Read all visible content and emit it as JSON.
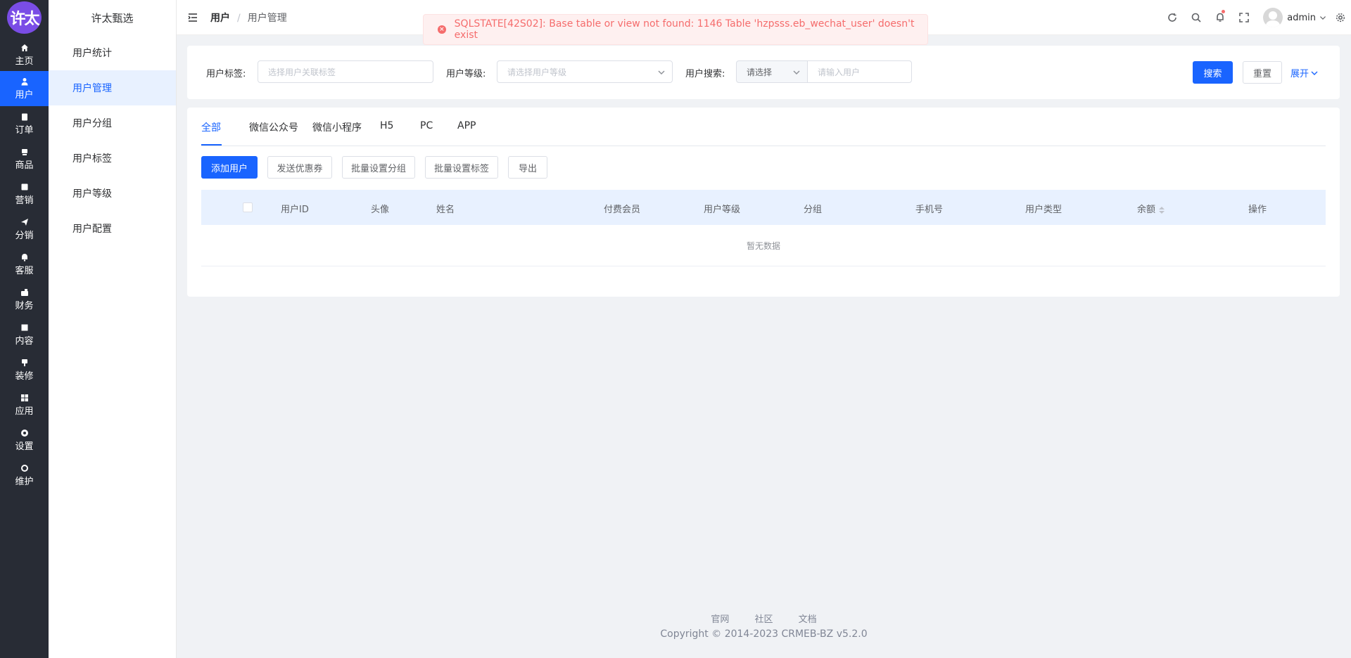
{
  "brand": {
    "logo_text": "许太",
    "name": "许太甄选"
  },
  "rail": [
    {
      "label": "主页",
      "icon": "home-icon"
    },
    {
      "label": "用户",
      "icon": "user-icon"
    },
    {
      "label": "订单",
      "icon": "clipboard-icon"
    },
    {
      "label": "商品",
      "icon": "box-icon"
    },
    {
      "label": "营销",
      "icon": "chart-icon"
    },
    {
      "label": "分销",
      "icon": "send-icon"
    },
    {
      "label": "客服",
      "icon": "bell-icon"
    },
    {
      "label": "财务",
      "icon": "wallet-icon"
    },
    {
      "label": "内容",
      "icon": "book-icon"
    },
    {
      "label": "装修",
      "icon": "brush-icon"
    },
    {
      "label": "应用",
      "icon": "grid-icon"
    },
    {
      "label": "设置",
      "icon": "gear-icon"
    },
    {
      "label": "维护",
      "icon": "cog-icon"
    }
  ],
  "submenu": [
    "用户统计",
    "用户管理",
    "用户分组",
    "用户标签",
    "用户等级",
    "用户配置"
  ],
  "breadcrumb": {
    "parent": "用户",
    "separator": "/",
    "current": "用户管理"
  },
  "header": {
    "username": "admin"
  },
  "error": {
    "text": "SQLSTATE[42S02]: Base table or view not found: 1146 Table 'hzpsss.eb_wechat_user' doesn't exist"
  },
  "filter": {
    "tag_label": "用户标签:",
    "tag_placeholder": "选择用户关联标签",
    "level_label": "用户等级:",
    "level_placeholder": "请选择用户等级",
    "search_label": "用户搜索:",
    "search_select": "请选择",
    "search_placeholder": "请输入用户",
    "search_btn": "搜索",
    "reset_btn": "重置",
    "expand": "展开"
  },
  "tabs": [
    "全部",
    "微信公众号",
    "微信小程序",
    "H5",
    "PC",
    "APP"
  ],
  "actions": [
    "添加用户",
    "发送优惠券",
    "批量设置分组",
    "批量设置标签",
    "导出"
  ],
  "table": {
    "columns": [
      "用户ID",
      "头像",
      "姓名",
      "付费会员",
      "用户等级",
      "分组",
      "手机号",
      "用户类型",
      "余额",
      "操作"
    ],
    "empty_text": "暂无数据"
  },
  "footer": {
    "links": [
      "官网",
      "社区",
      "文档"
    ],
    "copyright": "Copyright © 2014-2023 CRMEB-BZ v5.2.0"
  },
  "colors": {
    "primary": "#1964ff",
    "rail_bg": "#282c35",
    "error": "#f56c6c"
  }
}
